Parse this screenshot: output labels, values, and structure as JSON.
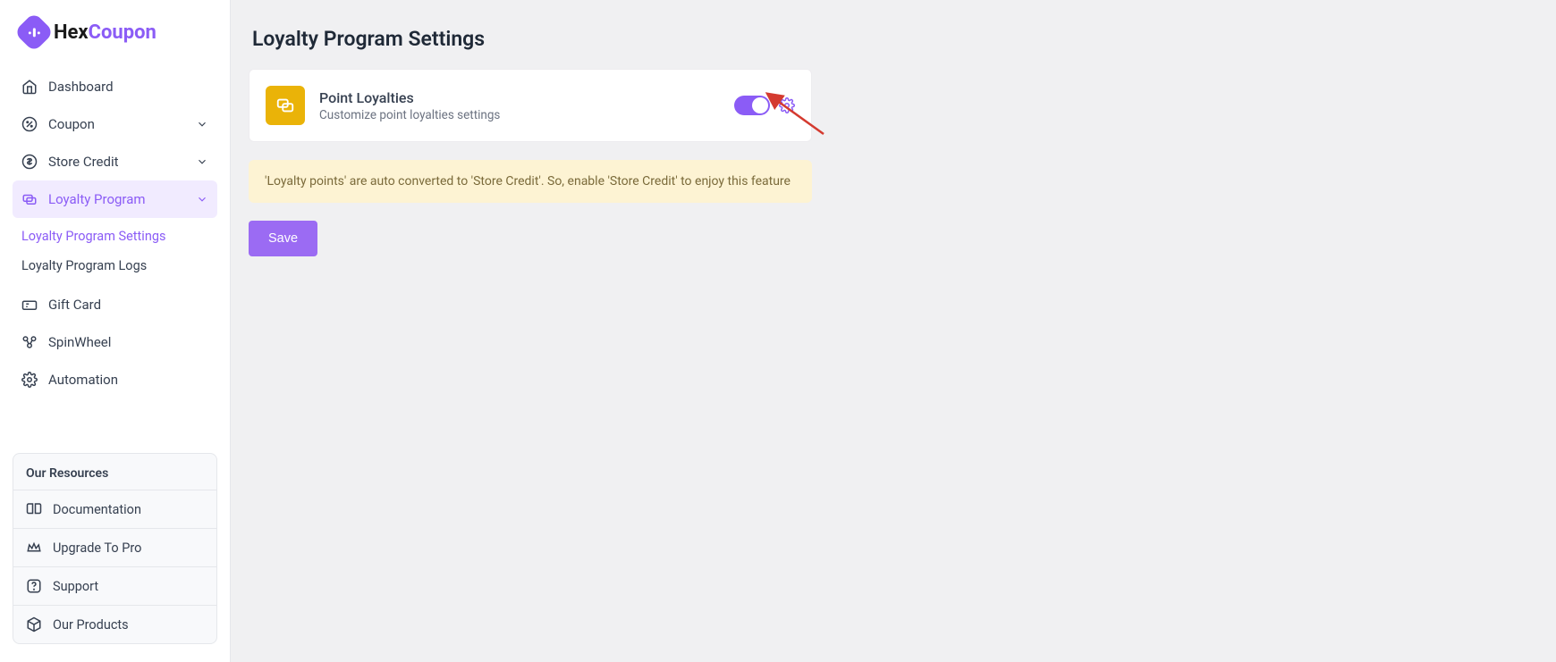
{
  "brand": {
    "hex": "Hex",
    "coupon": "Coupon"
  },
  "nav": {
    "dashboard": "Dashboard",
    "coupon": "Coupon",
    "store_credit": "Store Credit",
    "loyalty_program": "Loyalty Program",
    "loyalty_settings": "Loyalty Program Settings",
    "loyalty_logs": "Loyalty Program Logs",
    "gift_card": "Gift Card",
    "spinwheel": "SpinWheel",
    "automation": "Automation"
  },
  "resources": {
    "title": "Our Resources",
    "documentation": "Documentation",
    "upgrade": "Upgrade To Pro",
    "support": "Support",
    "products": "Our Products"
  },
  "page": {
    "title": "Loyalty Program Settings",
    "card": {
      "title": "Point Loyalties",
      "desc": "Customize point loyalties settings"
    },
    "alert": "'Loyalty points' are auto converted to 'Store Credit'. So, enable 'Store Credit' to enjoy this feature",
    "save": "Save"
  }
}
